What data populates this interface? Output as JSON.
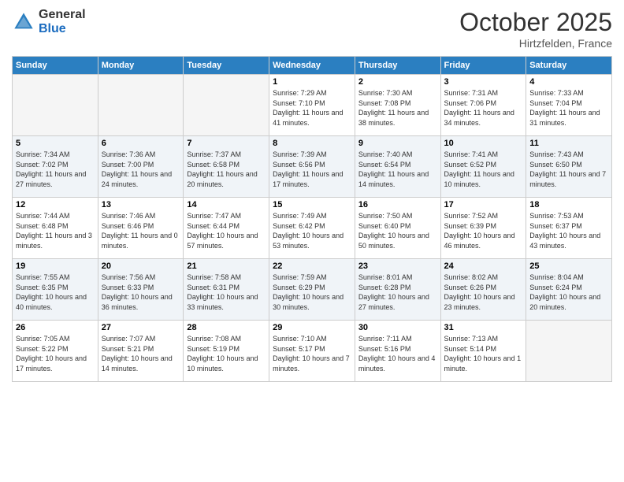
{
  "logo": {
    "general": "General",
    "blue": "Blue"
  },
  "title": "October 2025",
  "location": "Hirtzfelden, France",
  "headers": [
    "Sunday",
    "Monday",
    "Tuesday",
    "Wednesday",
    "Thursday",
    "Friday",
    "Saturday"
  ],
  "rows": [
    [
      {
        "day": "",
        "empty": true
      },
      {
        "day": "",
        "empty": true
      },
      {
        "day": "",
        "empty": true
      },
      {
        "day": "1",
        "sunrise": "Sunrise: 7:29 AM",
        "sunset": "Sunset: 7:10 PM",
        "daylight": "Daylight: 11 hours and 41 minutes."
      },
      {
        "day": "2",
        "sunrise": "Sunrise: 7:30 AM",
        "sunset": "Sunset: 7:08 PM",
        "daylight": "Daylight: 11 hours and 38 minutes."
      },
      {
        "day": "3",
        "sunrise": "Sunrise: 7:31 AM",
        "sunset": "Sunset: 7:06 PM",
        "daylight": "Daylight: 11 hours and 34 minutes."
      },
      {
        "day": "4",
        "sunrise": "Sunrise: 7:33 AM",
        "sunset": "Sunset: 7:04 PM",
        "daylight": "Daylight: 11 hours and 31 minutes."
      }
    ],
    [
      {
        "day": "5",
        "sunrise": "Sunrise: 7:34 AM",
        "sunset": "Sunset: 7:02 PM",
        "daylight": "Daylight: 11 hours and 27 minutes."
      },
      {
        "day": "6",
        "sunrise": "Sunrise: 7:36 AM",
        "sunset": "Sunset: 7:00 PM",
        "daylight": "Daylight: 11 hours and 24 minutes."
      },
      {
        "day": "7",
        "sunrise": "Sunrise: 7:37 AM",
        "sunset": "Sunset: 6:58 PM",
        "daylight": "Daylight: 11 hours and 20 minutes."
      },
      {
        "day": "8",
        "sunrise": "Sunrise: 7:39 AM",
        "sunset": "Sunset: 6:56 PM",
        "daylight": "Daylight: 11 hours and 17 minutes."
      },
      {
        "day": "9",
        "sunrise": "Sunrise: 7:40 AM",
        "sunset": "Sunset: 6:54 PM",
        "daylight": "Daylight: 11 hours and 14 minutes."
      },
      {
        "day": "10",
        "sunrise": "Sunrise: 7:41 AM",
        "sunset": "Sunset: 6:52 PM",
        "daylight": "Daylight: 11 hours and 10 minutes."
      },
      {
        "day": "11",
        "sunrise": "Sunrise: 7:43 AM",
        "sunset": "Sunset: 6:50 PM",
        "daylight": "Daylight: 11 hours and 7 minutes."
      }
    ],
    [
      {
        "day": "12",
        "sunrise": "Sunrise: 7:44 AM",
        "sunset": "Sunset: 6:48 PM",
        "daylight": "Daylight: 11 hours and 3 minutes."
      },
      {
        "day": "13",
        "sunrise": "Sunrise: 7:46 AM",
        "sunset": "Sunset: 6:46 PM",
        "daylight": "Daylight: 11 hours and 0 minutes."
      },
      {
        "day": "14",
        "sunrise": "Sunrise: 7:47 AM",
        "sunset": "Sunset: 6:44 PM",
        "daylight": "Daylight: 10 hours and 57 minutes."
      },
      {
        "day": "15",
        "sunrise": "Sunrise: 7:49 AM",
        "sunset": "Sunset: 6:42 PM",
        "daylight": "Daylight: 10 hours and 53 minutes."
      },
      {
        "day": "16",
        "sunrise": "Sunrise: 7:50 AM",
        "sunset": "Sunset: 6:40 PM",
        "daylight": "Daylight: 10 hours and 50 minutes."
      },
      {
        "day": "17",
        "sunrise": "Sunrise: 7:52 AM",
        "sunset": "Sunset: 6:39 PM",
        "daylight": "Daylight: 10 hours and 46 minutes."
      },
      {
        "day": "18",
        "sunrise": "Sunrise: 7:53 AM",
        "sunset": "Sunset: 6:37 PM",
        "daylight": "Daylight: 10 hours and 43 minutes."
      }
    ],
    [
      {
        "day": "19",
        "sunrise": "Sunrise: 7:55 AM",
        "sunset": "Sunset: 6:35 PM",
        "daylight": "Daylight: 10 hours and 40 minutes."
      },
      {
        "day": "20",
        "sunrise": "Sunrise: 7:56 AM",
        "sunset": "Sunset: 6:33 PM",
        "daylight": "Daylight: 10 hours and 36 minutes."
      },
      {
        "day": "21",
        "sunrise": "Sunrise: 7:58 AM",
        "sunset": "Sunset: 6:31 PM",
        "daylight": "Daylight: 10 hours and 33 minutes."
      },
      {
        "day": "22",
        "sunrise": "Sunrise: 7:59 AM",
        "sunset": "Sunset: 6:29 PM",
        "daylight": "Daylight: 10 hours and 30 minutes."
      },
      {
        "day": "23",
        "sunrise": "Sunrise: 8:01 AM",
        "sunset": "Sunset: 6:28 PM",
        "daylight": "Daylight: 10 hours and 27 minutes."
      },
      {
        "day": "24",
        "sunrise": "Sunrise: 8:02 AM",
        "sunset": "Sunset: 6:26 PM",
        "daylight": "Daylight: 10 hours and 23 minutes."
      },
      {
        "day": "25",
        "sunrise": "Sunrise: 8:04 AM",
        "sunset": "Sunset: 6:24 PM",
        "daylight": "Daylight: 10 hours and 20 minutes."
      }
    ],
    [
      {
        "day": "26",
        "sunrise": "Sunrise: 7:05 AM",
        "sunset": "Sunset: 5:22 PM",
        "daylight": "Daylight: 10 hours and 17 minutes."
      },
      {
        "day": "27",
        "sunrise": "Sunrise: 7:07 AM",
        "sunset": "Sunset: 5:21 PM",
        "daylight": "Daylight: 10 hours and 14 minutes."
      },
      {
        "day": "28",
        "sunrise": "Sunrise: 7:08 AM",
        "sunset": "Sunset: 5:19 PM",
        "daylight": "Daylight: 10 hours and 10 minutes."
      },
      {
        "day": "29",
        "sunrise": "Sunrise: 7:10 AM",
        "sunset": "Sunset: 5:17 PM",
        "daylight": "Daylight: 10 hours and 7 minutes."
      },
      {
        "day": "30",
        "sunrise": "Sunrise: 7:11 AM",
        "sunset": "Sunset: 5:16 PM",
        "daylight": "Daylight: 10 hours and 4 minutes."
      },
      {
        "day": "31",
        "sunrise": "Sunrise: 7:13 AM",
        "sunset": "Sunset: 5:14 PM",
        "daylight": "Daylight: 10 hours and 1 minute."
      },
      {
        "day": "",
        "empty": true
      }
    ]
  ]
}
